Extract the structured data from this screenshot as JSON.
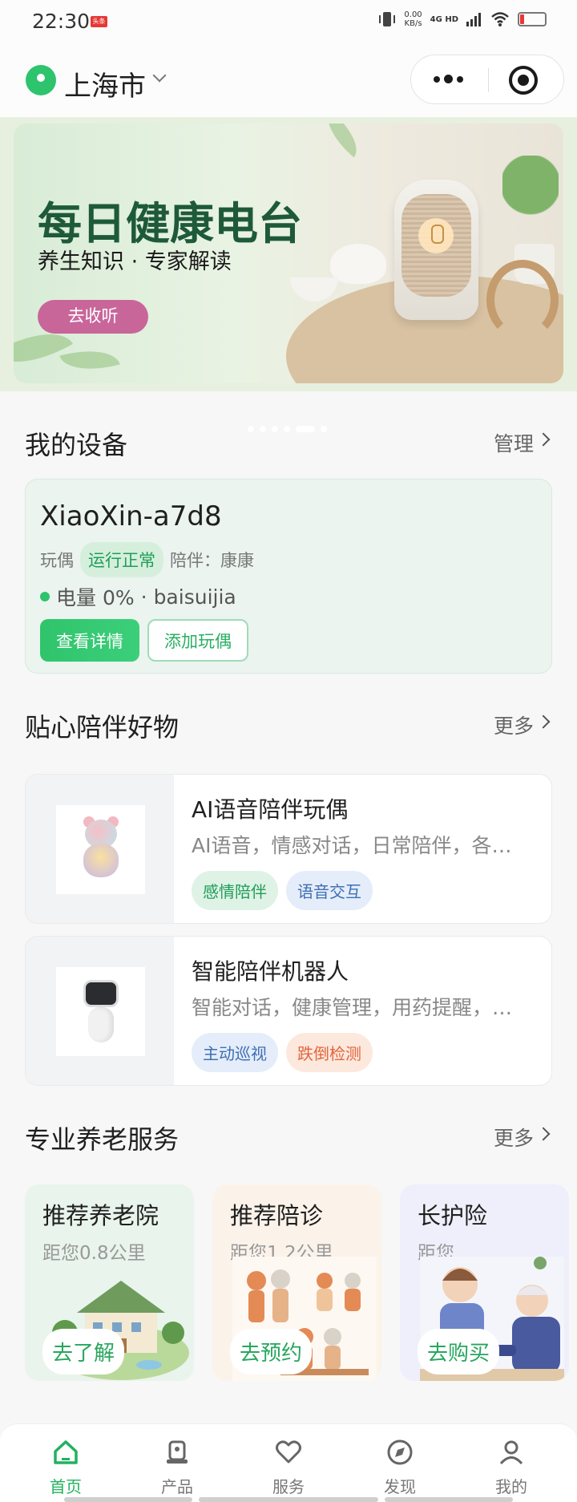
{
  "status_bar": {
    "time": "22:30",
    "badge": "头条",
    "net_speed": "0.00",
    "net_unit": "KB/s",
    "signal": "4G HD"
  },
  "header": {
    "city": "上海市"
  },
  "banner": {
    "title": "每日健康电台",
    "subtitle": "养生知识 · 专家解读",
    "cta": "去收听"
  },
  "devices": {
    "title": "我的设备",
    "more": "管理",
    "device": {
      "name": "XiaoXin-a7d8",
      "type": "玩偶",
      "status": "运行正常",
      "companion": "陪伴：康康",
      "power": "电量 0%",
      "sep": "·",
      "user": "baisuijia",
      "detail_button": "查看详情",
      "add_button": "添加玩偶"
    }
  },
  "products": {
    "title": "贴心陪伴好物",
    "more": "更多",
    "items": [
      {
        "title": "AI语音陪伴玩偶",
        "desc": "AI语音，情感对话，日常陪伴，各…",
        "tags": [
          "感情陪伴",
          "语音交互"
        ],
        "tag_colors": [
          "green",
          "blue"
        ]
      },
      {
        "title": "智能陪伴机器人",
        "desc": "智能对话，健康管理，用药提醒，…",
        "tags": [
          "主动巡视",
          "跌倒检测"
        ],
        "tag_colors": [
          "blue",
          "orange"
        ]
      }
    ]
  },
  "services": {
    "title": "专业养老服务",
    "more": "更多",
    "items": [
      {
        "title": "推荐养老院",
        "dist": "距您0.8公里",
        "button": "去了解",
        "bg": "#e9f4ec"
      },
      {
        "title": "推荐陪诊",
        "dist": "距您1.2公里",
        "button": "去预约",
        "bg": "#fbf3ea"
      },
      {
        "title": "长护险",
        "dist": "距您",
        "button": "去购买",
        "bg": "#eeeffa"
      }
    ]
  },
  "tabbar": {
    "items": [
      {
        "label": "首页",
        "icon": "home-icon",
        "active": true
      },
      {
        "label": "产品",
        "icon": "product-icon",
        "active": false
      },
      {
        "label": "服务",
        "icon": "heart-icon",
        "active": false
      },
      {
        "label": "发现",
        "icon": "compass-icon",
        "active": false
      },
      {
        "label": "我的",
        "icon": "user-icon",
        "active": false
      }
    ]
  },
  "colors": {
    "accent": "#21b25f",
    "banner_cta": "#c8669a",
    "tag_green": "#1f9e57",
    "tag_blue": "#3f6fb4",
    "tag_orange": "#e2663c"
  }
}
